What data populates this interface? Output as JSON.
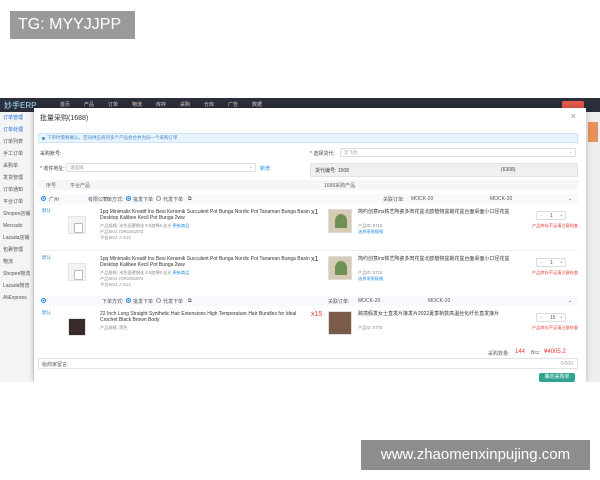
{
  "watermarks": {
    "top": "TG: MYYJJPP",
    "bottom": "www.zhaomenxinpujing.com"
  },
  "app": {
    "top_nav": [
      "首页",
      "产品",
      "订单",
      "物流",
      "库存",
      "采购",
      "仓库",
      "广告",
      "数据"
    ],
    "logo": "妙手ERP"
  },
  "sidebar": {
    "items": [
      "订单管理",
      "订单处理",
      "订单列表",
      "手工订单",
      "采购单",
      "发货管理",
      "订单通知",
      "平台订单",
      "Shopee店铺",
      "Mercado",
      "Lazada店铺",
      "包裹管理",
      "物流",
      "Shopee物流",
      "Lazada物流",
      "AliExpress"
    ]
  },
  "modal": {
    "title": "批量采购(1688)",
    "notice": "下单时需要确认，若同供应商的多个产品会合并为同一个采购订单",
    "account_label": "采购账号:",
    "address_label": "* 收件地址:",
    "address_placeholder": "请选择",
    "address_action": "新增",
    "method_label": "* 选择货代:",
    "method_value": "云飞达",
    "forwarder_info": "货代编号: 1508",
    "forwarder_tail": "(6308)",
    "table_headers": {
      "idx": "序号",
      "product": "平台产品",
      "source": "1688采购产品"
    },
    "groups": [
      {
        "label": "广州",
        "label_tail": "有限公司",
        "order_mode_label": "下单方式:",
        "opt_batch": "批发下单",
        "opt_dropship": "代发下单",
        "order_no_label": "关联订单:",
        "order_no_a": "MOCK-20",
        "order_no_b": "MOCK-20"
      },
      {
        "label": "",
        "label_tail": "",
        "order_mode_label": "下单方式:",
        "opt_batch": "批发下单",
        "opt_dropship": "代发下单",
        "order_no_label": "关联订单:",
        "order_no_a": "MOCK-20",
        "order_no_b": "MOCK-20"
      }
    ],
    "items": [
      {
        "tag": "默认",
        "name": "1pq Minimalis Kreatif Ins Besi Keramik Succulent Pot Bunga Nordic Pot Tanaman Bunga Basin Desktop Kalibee Kecil Pot Bunga 2ww",
        "meta1": "产品规格: 米色面罩钢化 9.5加棉6 丝光",
        "meta1_link": "更新商品",
        "meta2": "产品SKU: IOR1041973",
        "meta3": "平台SKU: A-X12",
        "qty": "x1",
        "pname": "简约创意ins铁艺陶瓷多肉花盆北欧植物盆栽花盆台面桌面小口径花盆",
        "pmeta1": "产品ID: 5715",
        "pmeta2": "选择采购规格",
        "stepper": "1",
        "warn": "产品库存不足请注意检查",
        "thumb": "pot",
        "pthumb": "plant"
      },
      {
        "tag": "默认",
        "name": "1pq Minimalis Kreatif Ins Besi Keramik Succulent Pot Bunga Nordic Pot Tanaman Bunga Basin Desktop Kalibee Kecil Pot Bunga 2ww",
        "meta1": "产品规格: 米色面罩钢化 9.5加棉6 丝光",
        "meta1_link": "更新商品",
        "meta2": "产品SKU: IOR1041973",
        "meta3": "平台SKU: A-X12",
        "qty": "x1",
        "pname": "简约创意ins铁艺陶瓷多肉花盆北欧植物盆栽花盆台面桌面小口径花盆",
        "pmeta1": "产品ID: 5715",
        "pmeta2": "选择采购规格",
        "stepper": "1",
        "warn": "产品库存不足请注意检查",
        "thumb": "pot",
        "pthumb": "plant"
      },
      {
        "tag": "默认",
        "name": "22 Inch Long Straight Synthetic Hair Extensions High Temperature Hair Bundles for Ideal Crochet Black Brown Body",
        "meta1": "产品规格: 黑色",
        "meta1_link": "",
        "meta2": "",
        "meta3": "",
        "qty": "x15",
        "pname": "跨境假发女士直发片接发片2022夏季新款高温丝化纤长直发接片",
        "pmeta1": "产品ID: 6775",
        "pmeta2": "",
        "stepper": "15",
        "warn": "产品库存不足请注意检查",
        "thumb": "hair",
        "pthumb": "hairp"
      }
    ],
    "summary": {
      "count_label": "采购数量:",
      "count": "144",
      "total_label": "Bcc:",
      "total": "¥4005.2"
    },
    "remark_label": "给商家留言:",
    "remark_counter": "0/500",
    "submit": "确定采购单"
  },
  "colors": {
    "accent": "#1e88e5",
    "danger": "#e53935",
    "primary_button": "#2fa38f"
  }
}
